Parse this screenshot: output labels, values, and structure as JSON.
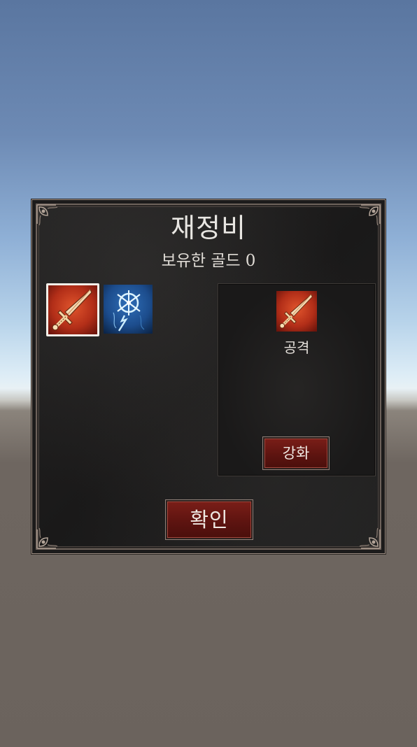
{
  "dialog": {
    "title": "재정비",
    "gold_label": "보유한 골드",
    "gold_value": "0"
  },
  "skills": [
    {
      "name": "sword",
      "icon": "sword-icon",
      "selected": true
    },
    {
      "name": "lightning-magic",
      "icon": "lightning-rune-icon",
      "selected": false
    }
  ],
  "detail": {
    "icon": "sword-icon",
    "name": "공격",
    "upgrade_label": "강화"
  },
  "confirm_label": "확인",
  "colors": {
    "panel_bg": "#1c1b1b",
    "button_red": "#6a1712",
    "selection_border": "#f2efe9"
  }
}
